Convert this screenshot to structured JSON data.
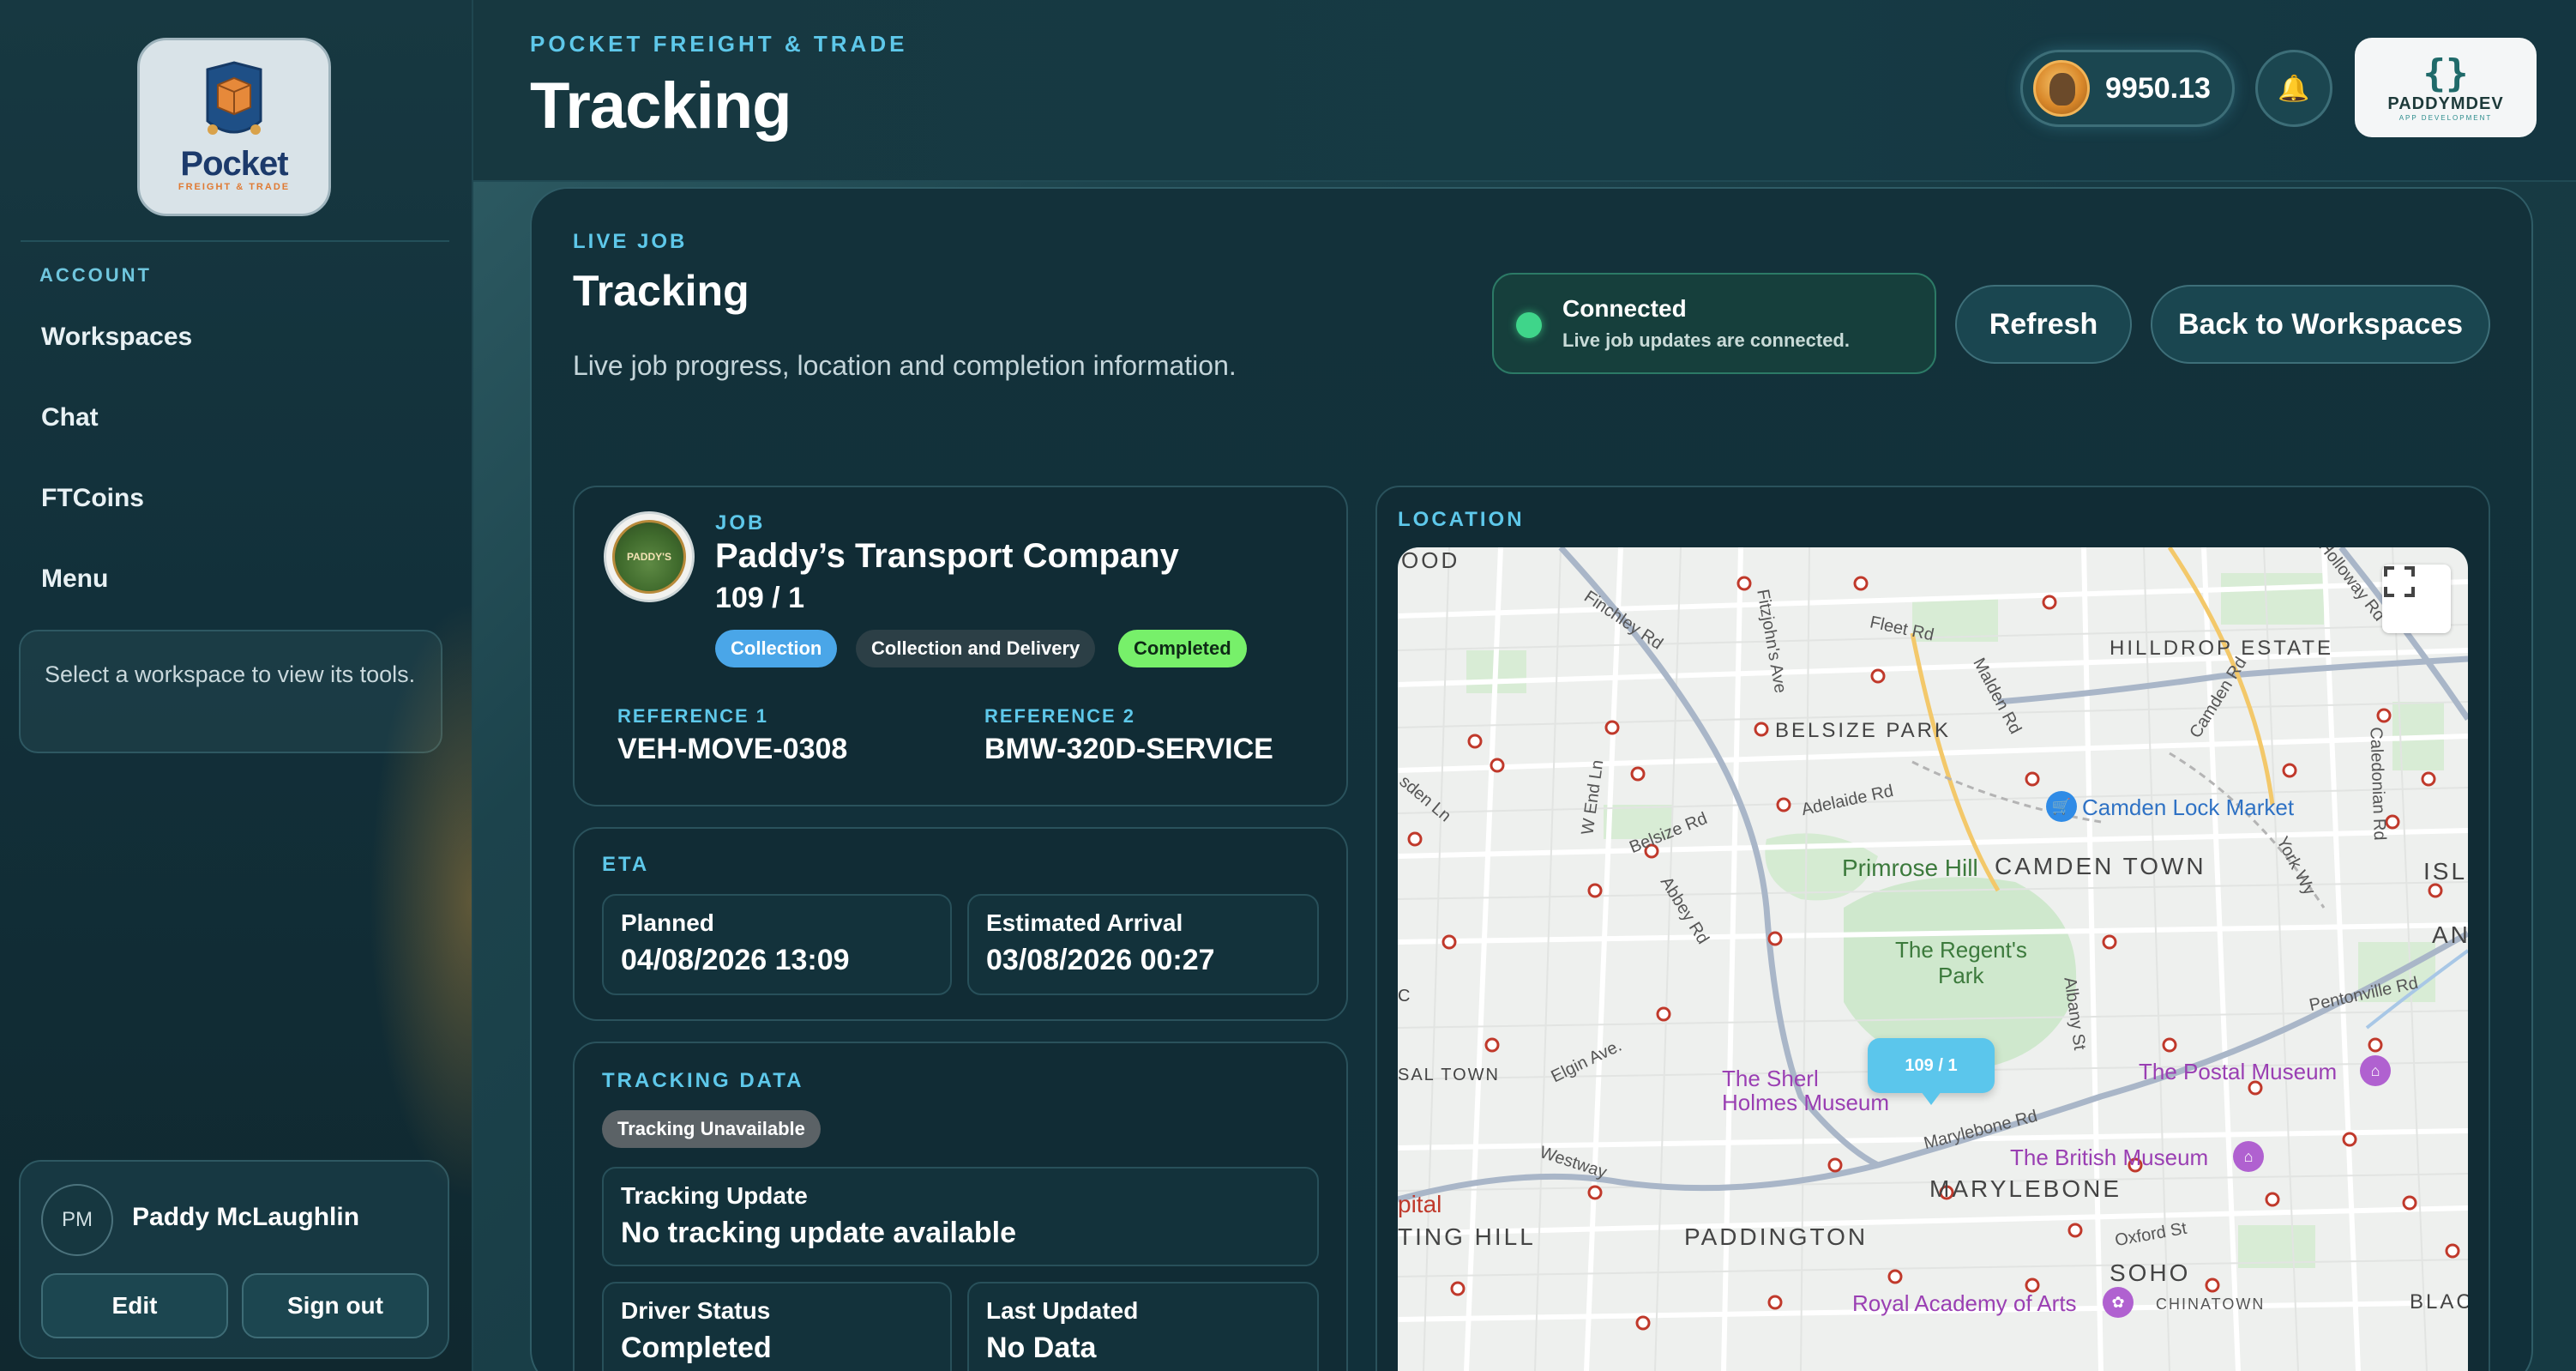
{
  "brand": {
    "logo_word": "Pocket",
    "logo_sub": "FREIGHT & TRADE"
  },
  "sidebar": {
    "account_label": "ACCOUNT",
    "items": [
      {
        "label": "Workspaces"
      },
      {
        "label": "Chat"
      },
      {
        "label": "FTCoins"
      },
      {
        "label": "Menu"
      }
    ],
    "hint": "Select a workspace to view its tools.",
    "user": {
      "initials": "PM",
      "name": "Paddy McLaughlin",
      "edit_label": "Edit",
      "signout_label": "Sign out"
    }
  },
  "header": {
    "eyebrow": "POCKET FREIGHT & TRADE",
    "title": "Tracking",
    "coins": "9950.13",
    "bell_icon": "bell-icon",
    "dev_logo": {
      "brace": "{}",
      "name": "PADDYMDEV",
      "sub": "APP DEVELOPMENT"
    }
  },
  "panel": {
    "eyebrow": "LIVE JOB",
    "title": "Tracking",
    "description": "Live job progress, location and completion information.",
    "connection": {
      "title": "Connected",
      "subtitle": "Live job updates are connected.",
      "color": "#3fd58a"
    },
    "refresh_label": "Refresh",
    "back_label": "Back to Workspaces"
  },
  "job": {
    "label": "JOB",
    "company": "Paddy’s Transport Company",
    "number": "109 / 1",
    "logo_text": "PADDY'S",
    "badges": [
      {
        "text": "Collection",
        "bg": "#4aa6e8",
        "fg": "#ffffff"
      },
      {
        "text": "Collection and Delivery",
        "bg": "#2c3f46",
        "fg": "#ffffff"
      },
      {
        "text": "Completed",
        "bg": "#77f06a",
        "fg": "#0e2a16"
      }
    ],
    "ref1_label": "REFERENCE 1",
    "ref1": "VEH-MOVE-0308",
    "ref2_label": "REFERENCE 2",
    "ref2": "BMW-320D-SERVICE"
  },
  "eta": {
    "label": "ETA",
    "planned_label": "Planned",
    "planned": "04/08/2026 13:09",
    "estimated_label": "Estimated Arrival",
    "estimated": "03/08/2026 00:27"
  },
  "tracking": {
    "label": "TRACKING DATA",
    "status_badge": "Tracking Unavailable",
    "update_label": "Tracking Update",
    "update_value": "No tracking update available",
    "driver_label": "Driver Status",
    "driver_value": "Completed",
    "last_label": "Last Updated",
    "last_value": "No Data"
  },
  "location": {
    "label": "LOCATION",
    "marker_label": "109 / 1",
    "place_labels": {
      "hilldrop": "HILLDROP ESTATE",
      "belsize": "BELSIZE PARK",
      "camden_town": "CAMDEN TOWN",
      "primrose": "Primrose Hill",
      "regents_1": "The Regent's",
      "regents_2": "Park",
      "camden_market": "Camden Lock Market",
      "marylebone": "MARYLEBONE",
      "paddington": "PADDINGTON",
      "soho": "SOHO",
      "chinatown": "CHINATOWN",
      "postal": "The Postal Museum",
      "british": "The British Museum",
      "royal": "Royal Academy of Arts",
      "sherlock_1": "The Sherl",
      "sherlock_2": "Holmes Museum",
      "notting": "TING HILL",
      "islington": "ISLI",
      "an": "AN",
      "black": "BLACK",
      "ood": "OOD",
      "sal_town": "SAL TOWN",
      "pital": "pital",
      "c": "C"
    },
    "road_labels": {
      "finchley": "Finchley Rd",
      "fitzjohns": "Fitzjohn's Ave",
      "fleet": "Fleet Rd",
      "malden": "Malden Rd",
      "camden_rd": "Camden Rd",
      "holloway": "Holloway Rd",
      "caledonian": "Caledonian Rd",
      "adelaide": "Adelaide Rd",
      "belsize_rd": "Belsize Rd",
      "abbey": "Abbey Rd",
      "wend": "W End Ln",
      "sden": "sden Ln",
      "elgin": "Elgin Ave.",
      "albany": "Albany St",
      "york": "York Wy",
      "pentonville": "Pentonville Rd",
      "marylebone_rd": "Marylebone Rd",
      "westway": "Westway",
      "oxford": "Oxford St"
    }
  }
}
